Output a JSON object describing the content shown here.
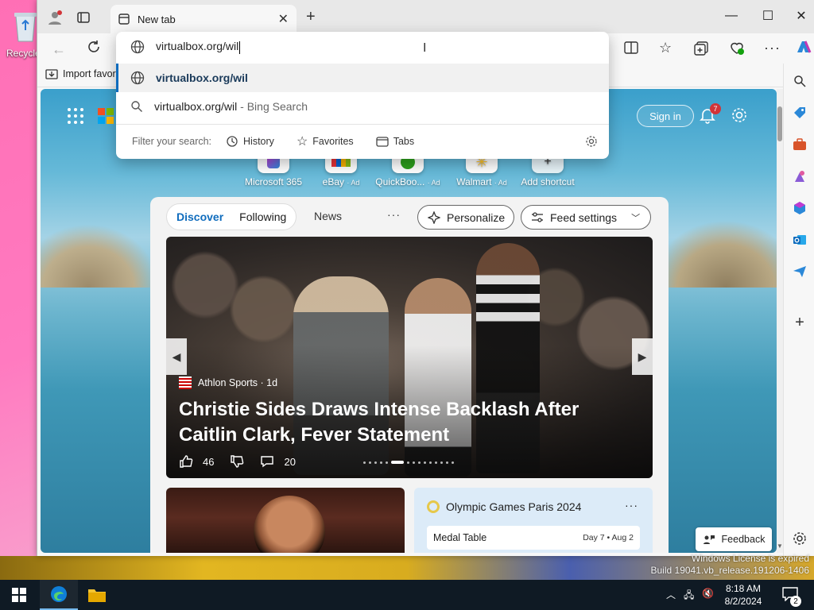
{
  "desktop": {
    "recycle_bin_label": "Recycle",
    "watermark_line1": "Windows License is expired",
    "watermark_line2": "Build 19041.vb_release.191206-1406"
  },
  "browser": {
    "tab_title": "New tab",
    "favorites_bar": {
      "import_label": "Import favor"
    },
    "omnibox": {
      "typed_text": "virtualbox.org/wil",
      "suggestions": [
        {
          "text": "virtualbox.org/wil",
          "icon": "globe-icon"
        },
        {
          "text": "virtualbox.org/wil",
          "suffix": " - Bing Search",
          "icon": "search-icon"
        }
      ],
      "filter_label": "Filter your search:",
      "filters": [
        "History",
        "Favorites",
        "Tabs"
      ]
    },
    "sidebar_icons": [
      "search-icon",
      "tag-icon",
      "toolbox-icon",
      "games-icon",
      "m365-icon",
      "outlook-icon",
      "send-icon",
      "add-icon",
      "settings-icon"
    ]
  },
  "msn": {
    "sign_in": "Sign in",
    "notification_count": "7",
    "shortcuts": [
      {
        "label": "Microsoft 365",
        "ad": ""
      },
      {
        "label": "eBay",
        "ad": "· Ad"
      },
      {
        "label": "QuickBoo...",
        "ad": "· Ad"
      },
      {
        "label": "Walmart",
        "ad": "· Ad"
      },
      {
        "label": "Add shortcut",
        "ad": ""
      }
    ],
    "feed_tabs": {
      "discover": "Discover",
      "following": "Following",
      "news": "News",
      "more": "···"
    },
    "personalize": "Personalize",
    "feed_settings": "Feed settings",
    "hero": {
      "source": "Athlon Sports · 1d",
      "headline": "Christie Sides Draws Intense Backlash After Caitlin Clark, Fever Statement",
      "likes": "46",
      "comments": "20"
    },
    "olympic_card": {
      "title": "Olympic Games Paris 2024",
      "more": "···",
      "row_label": "Medal Table",
      "row_date": "Day 7 • Aug 2"
    },
    "feedback": "Feedback"
  },
  "taskbar": {
    "time": "8:18 AM",
    "date": "8/2/2024",
    "notification_count": "2"
  },
  "colors": {
    "accent": "#0f6cbd",
    "taskbar": "#0f1a24"
  }
}
